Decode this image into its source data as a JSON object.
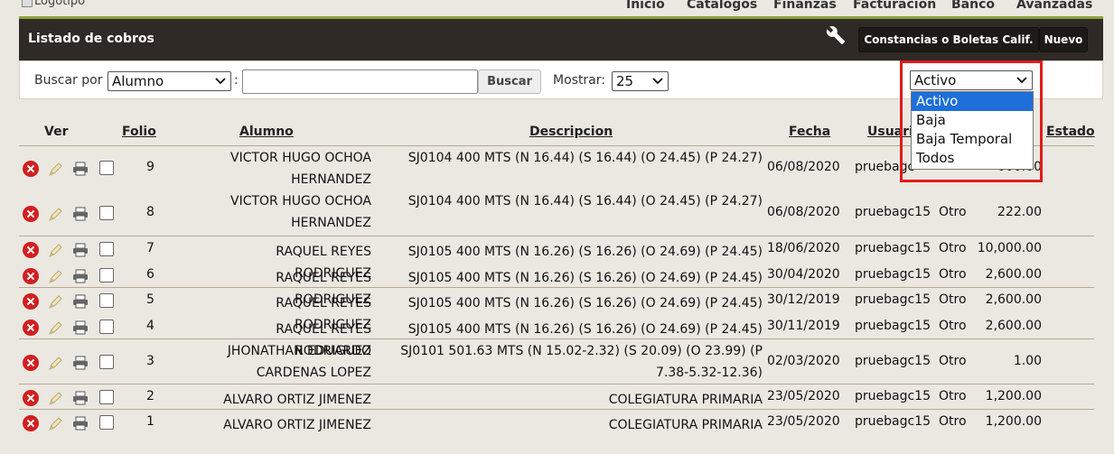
{
  "logo_alt": "Logotipo",
  "nav": [
    "Inicio",
    "Catalogos",
    "Finanzas",
    "Facturacion",
    "Banco",
    "Avanzadas"
  ],
  "header": {
    "title": "Listado de cobros",
    "btn_constancias": "Constancias o Boletas Calif.",
    "btn_nuevo": "Nuevo"
  },
  "search": {
    "label_buscar_por": "Buscar por",
    "buscar_por_value": "Alumno",
    "colon": ":",
    "query_value": "",
    "btn_buscar": "Buscar",
    "label_mostrar": "Mostrar:",
    "mostrar_value": "25",
    "estado_value": "Activo",
    "estado_options": [
      "Activo",
      "Baja",
      "Baja Temporal",
      "Todos"
    ]
  },
  "table": {
    "headers": {
      "ver": "Ver",
      "folio": "Folio",
      "alumno": "Alumno",
      "descripcion": "Descripcion",
      "fecha": "Fecha",
      "usuario": "Usuari",
      "estado": "Estado"
    },
    "rows": [
      {
        "folio": "9",
        "alumno": "VICTOR HUGO OCHOA HERNANDEZ",
        "descripcion": "SJ0104 400 MTS (N 16.44) (S 16.44) (O 24.45) (P 24.27)",
        "fecha": "06/08/2020",
        "usuario": "pruebagc",
        "tipo": "",
        "monto": "000.00"
      },
      {
        "folio": "8",
        "alumno": "VICTOR HUGO OCHOA HERNANDEZ",
        "descripcion": "SJ0104 400 MTS (N 16.44) (S 16.44) (O 24.45) (P 24.27)",
        "fecha": "06/08/2020",
        "usuario": "pruebagc15",
        "tipo": "Otro",
        "monto": "222.00"
      },
      {
        "folio": "7",
        "alumno": "RAQUEL REYES RODRIGUEZ",
        "descripcion": "SJ0105 400 MTS (N 16.26) (S 16.26) (O 24.69) (P 24.45)",
        "fecha": "18/06/2020",
        "usuario": "pruebagc15",
        "tipo": "Otro",
        "monto": "10,000.00"
      },
      {
        "folio": "6",
        "alumno": "RAQUEL REYES RODRIGUEZ",
        "descripcion": "SJ0105 400 MTS (N 16.26) (S 16.26) (O 24.69) (P 24.45)",
        "fecha": "30/04/2020",
        "usuario": "pruebagc15",
        "tipo": "Otro",
        "monto": "2,600.00"
      },
      {
        "folio": "5",
        "alumno": "RAQUEL REYES RODRIGUEZ",
        "descripcion": "SJ0105 400 MTS (N 16.26) (S 16.26) (O 24.69) (P 24.45)",
        "fecha": "30/12/2019",
        "usuario": "pruebagc15",
        "tipo": "Otro",
        "monto": "2,600.00"
      },
      {
        "folio": "4",
        "alumno": "RAQUEL REYES RODRIGUEZ",
        "descripcion": "SJ0105 400 MTS (N 16.26) (S 16.26) (O 24.69) (P 24.45)",
        "fecha": "30/11/2019",
        "usuario": "pruebagc15",
        "tipo": "Otro",
        "monto": "2,600.00"
      },
      {
        "folio": "3",
        "alumno": "JHONATHAN EDUARDO CARDENAS LOPEZ",
        "descripcion": "SJ0101 501.63 MTS (N 15.02-2.32) (S 20.09) (O 23.99) (P 7.38-5.32-12.36)",
        "fecha": "02/03/2020",
        "usuario": "pruebagc15",
        "tipo": "Otro",
        "monto": "1.00"
      },
      {
        "folio": "2",
        "alumno": "ALVARO ORTIZ JIMENEZ",
        "descripcion": "COLEGIATURA PRIMARIA",
        "fecha": "23/05/2020",
        "usuario": "pruebagc15",
        "tipo": "Otro",
        "monto": "1,200.00"
      },
      {
        "folio": "1",
        "alumno": "ALVARO ORTIZ JIMENEZ",
        "descripcion": "COLEGIATURA PRIMARIA",
        "fecha": "23/05/2020",
        "usuario": "pruebagc15",
        "tipo": "Otro",
        "monto": "1,200.00"
      }
    ]
  },
  "colors": {
    "header_bg": "#2f2a26",
    "accent_green": "#8aa23a",
    "highlight_box": "#e31b1b",
    "dropdown_selected": "#1e6fd9",
    "delete_red": "#d21f1f"
  },
  "icons": {
    "delete": "delete-icon",
    "edit": "edit-icon",
    "print": "print-icon",
    "settings": "wrench-icon"
  }
}
